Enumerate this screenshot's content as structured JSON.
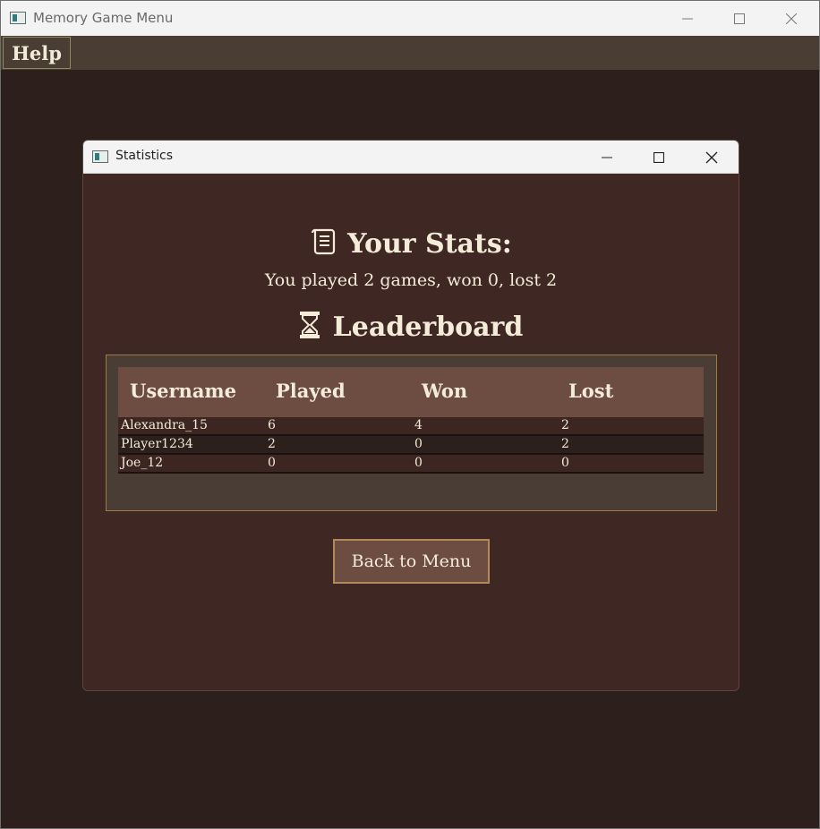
{
  "main_window": {
    "title": "Memory Game Menu",
    "menu": {
      "help_label": "Help"
    }
  },
  "dialog": {
    "title": "Statistics",
    "your_stats_heading": "Your Stats:",
    "your_stats_line": "You played 2 games, won 0, lost 2",
    "leaderboard_heading": "Leaderboard",
    "leaderboard": {
      "columns": [
        "Username",
        "Played",
        "Won",
        "Lost"
      ],
      "rows": [
        [
          "Alexandra_15",
          "6",
          "4",
          "2"
        ],
        [
          "Player1234",
          "2",
          "0",
          "2"
        ],
        [
          "Joe_12",
          "0",
          "0",
          "0"
        ]
      ]
    },
    "back_label": "Back to Menu"
  },
  "icons": {
    "stats": "scroll-icon",
    "leaderboard": "hourglass-icon",
    "minimize": "minimize-icon",
    "maximize": "maximize-icon",
    "close": "close-icon"
  },
  "colors": {
    "background": "#2d1f1c",
    "dialog_bg": "#3f2724",
    "accent": "#6d4c42",
    "text": "#f4ecd8",
    "border": "#b08a5a"
  }
}
